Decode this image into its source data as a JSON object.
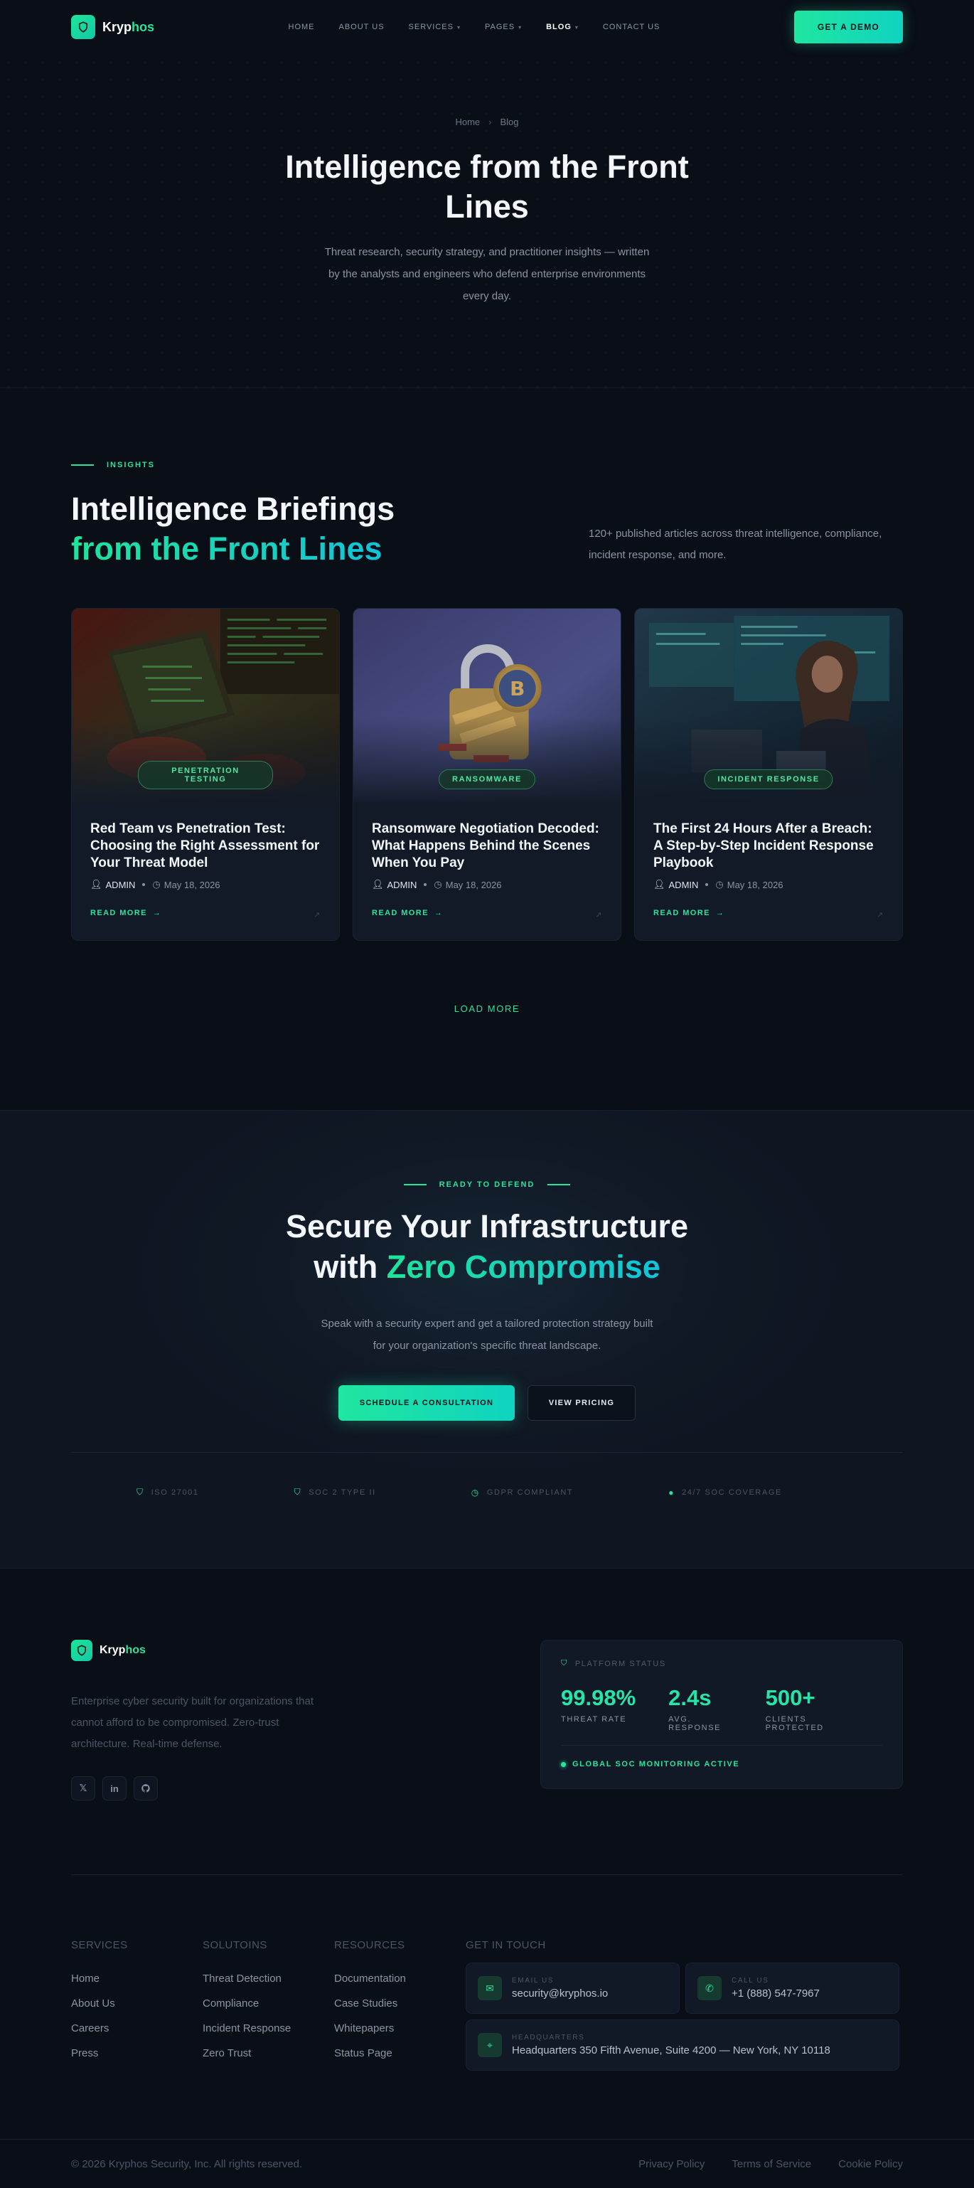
{
  "nav": {
    "brand_a": "Kryp",
    "brand_b": "hos",
    "items": [
      {
        "label": "HOME"
      },
      {
        "label": "ABOUT US"
      },
      {
        "label": "SERVICES"
      },
      {
        "label": "PAGES"
      },
      {
        "label": "BLOG"
      },
      {
        "label": "CONTACT US"
      }
    ],
    "cta": "GET A DEMO"
  },
  "hero": {
    "crumb_home": "Home",
    "crumb_sep": "›",
    "crumb_current": "Blog",
    "title": "Intelligence from the Front Lines",
    "subtitle": "Threat research, security strategy, and practitioner insights — written by the analysts and engineers who defend enterprise environments every day."
  },
  "insights": {
    "eyebrow": "INSIGHTS",
    "title_a": "Intelligence Briefings",
    "title_b": "from the Front Lines",
    "desc": "120+ published articles across threat intelligence, compliance, incident response, and more.",
    "cards": [
      {
        "tag": "PENETRATION TESTING",
        "title": "Red Team vs Penetration Test: Choosing the Right Assessment for Your Threat Model",
        "author": "ADMIN",
        "date": "May 18, 2026",
        "link": "READ MORE"
      },
      {
        "tag": "RANSOMWARE",
        "title": "Ransomware Negotiation Decoded: What Happens Behind the Scenes When You Pay",
        "author": "ADMIN",
        "date": "May 18, 2026",
        "link": "READ MORE"
      },
      {
        "tag": "INCIDENT RESPONSE",
        "title": "The First 24 Hours After a Breach: A Step-by-Step Incident Response Playbook",
        "author": "ADMIN",
        "date": "May 18, 2026",
        "link": "READ MORE"
      }
    ],
    "load_more": "LOAD MORE"
  },
  "cta": {
    "eyebrow": "READY TO DEFEND",
    "title_a": "Secure Your Infrastructure",
    "title_b": "with ",
    "title_c": "Zero Compromise",
    "desc": "Speak with a security expert and get a tailored protection strategy built for your organization's specific threat landscape.",
    "primary": "SCHEDULE A CONSULTATION",
    "secondary": "VIEW PRICING",
    "trust": [
      {
        "icon": "shield-icon",
        "label": "ISO 27001"
      },
      {
        "icon": "shield-icon",
        "label": "SOC 2 TYPE II"
      },
      {
        "icon": "clock-icon",
        "label": "GDPR COMPLIANT"
      },
      {
        "icon": "dot-icon",
        "label": "24/7 SOC COVERAGE"
      }
    ]
  },
  "footer": {
    "about": "Enterprise cyber security built for organizations that cannot afford to be compromised. Zero-trust architecture. Real-time defense.",
    "social": [
      "x-icon",
      "linkedin-icon",
      "github-icon"
    ],
    "status": {
      "title": "PLATFORM STATUS",
      "stats": [
        {
          "value": "99.98%",
          "label": "THREAT RATE"
        },
        {
          "value": "2.4s",
          "label": "AVG. RESPONSE"
        },
        {
          "value": "500+",
          "label": "CLIENTS PROTECTED"
        }
      ],
      "live": "GLOBAL SOC MONITORING ACTIVE"
    },
    "cols": [
      {
        "title": "SERVICES",
        "items": [
          "Home",
          "About Us",
          "Careers",
          "Press"
        ]
      },
      {
        "title": "SOLUTOINS",
        "items": [
          "Threat Detection",
          "Compliance",
          "Incident Response",
          "Zero Trust"
        ]
      },
      {
        "title": "RESOURCES",
        "items": [
          "Documentation",
          "Case Studies",
          "Whitepapers",
          "Status Page"
        ]
      }
    ],
    "contact": {
      "title": "GET IN TOUCH",
      "email_label": "EMAIL US",
      "email": "security@kryphos.io",
      "phone_label": "CALL US",
      "phone": "+1 (888) 547-7967",
      "hq_label": "HEADQUARTERS",
      "hq": "Headquarters 350 Fifth Avenue, Suite 4200 — New York, NY 10118"
    },
    "copyright": "© 2026 Kryphos Security, Inc. All rights reserved.",
    "legal": [
      "Privacy Policy",
      "Terms of Service",
      "Cookie Policy"
    ]
  },
  "colors": {
    "accent": "#27e59b",
    "accent2": "#12c3d9",
    "bg": "#0a0e16",
    "card": "#121a27"
  }
}
